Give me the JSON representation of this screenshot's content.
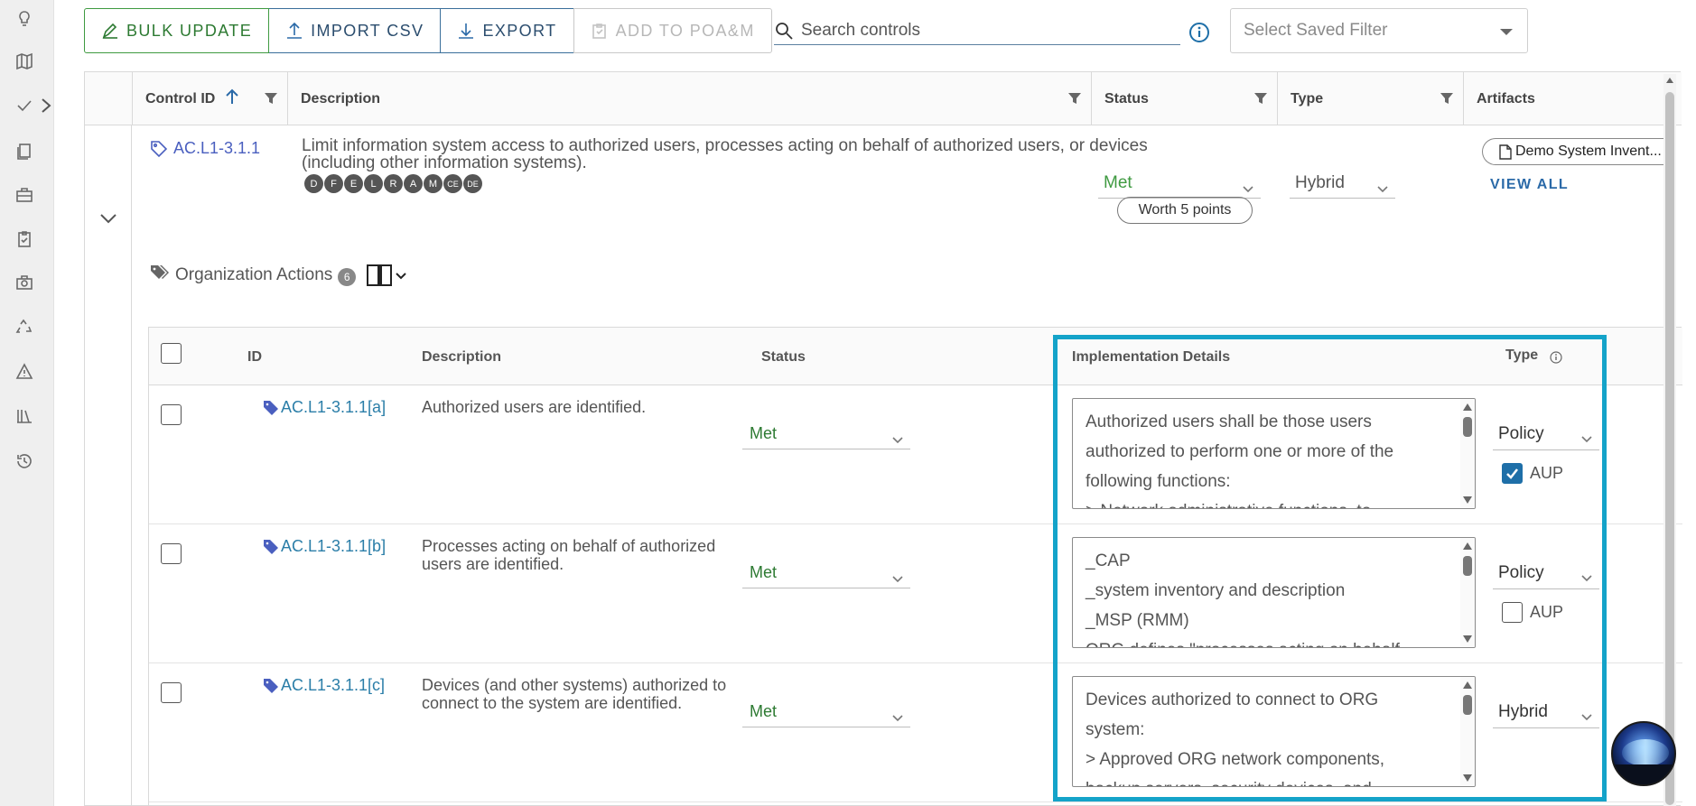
{
  "toolbar": {
    "bulk_update": "BULK UPDATE",
    "import_csv": "IMPORT CSV",
    "export": "EXPORT",
    "add_to_poam": "ADD TO POA&M"
  },
  "search": {
    "placeholder": "Search controls"
  },
  "saved_filter": {
    "placeholder": "Select Saved Filter"
  },
  "grid": {
    "columns": {
      "control_id": "Control ID",
      "description": "Description",
      "status": "Status",
      "type": "Type",
      "artifacts": "Artifacts"
    }
  },
  "control": {
    "id": "AC.L1-3.1.1",
    "description": "Limit information system access to authorized users, processes acting on behalf of authorized users, or devices (including other information systems).",
    "badges": [
      "D",
      "F",
      "E",
      "L",
      "R",
      "A",
      "M",
      "CE",
      "DE"
    ],
    "status": "Met",
    "type": "Hybrid",
    "worth": "Worth 5 points",
    "artifact": "Demo System Invent...",
    "view_all": "VIEW ALL"
  },
  "org_actions": {
    "label": "Organization Actions",
    "count": "6",
    "columns": {
      "id": "ID",
      "description": "Description",
      "status": "Status",
      "implementation": "Implementation Details",
      "type": "Type"
    },
    "rows": [
      {
        "id": "AC.L1-3.1.1[a]",
        "description": "Authorized users are identified.",
        "status": "Met",
        "implementation_lines": [
          "Authorized users shall be those users",
          "authorized to perform one or more of the",
          "following functions:",
          "> Network administrative functions, to"
        ],
        "type": "Policy",
        "aup_label": "AUP",
        "aup_checked": true
      },
      {
        "id": "AC.L1-3.1.1[b]",
        "description": "Processes acting on behalf of authorized users are identified.",
        "status": "Met",
        "implementation_lines": [
          "_CAP",
          "_system inventory and description",
          "_MSP (RMM)",
          "ORG defines \"processes acting on behalf"
        ],
        "type": "Policy",
        "aup_label": "AUP",
        "aup_checked": false
      },
      {
        "id": "AC.L1-3.1.1[c]",
        "description": "Devices (and other systems) authorized to connect to the system are identified.",
        "status": "Met",
        "implementation_lines": [
          "Devices authorized to connect to ORG",
          "system:",
          "> Approved ORG network components,",
          "backup servers, security devices, and"
        ],
        "type": "Hybrid"
      }
    ]
  },
  "colors": {
    "accent": "#2b6aa8",
    "met_green": "#2d7a32",
    "highlight": "#14a3c9"
  }
}
